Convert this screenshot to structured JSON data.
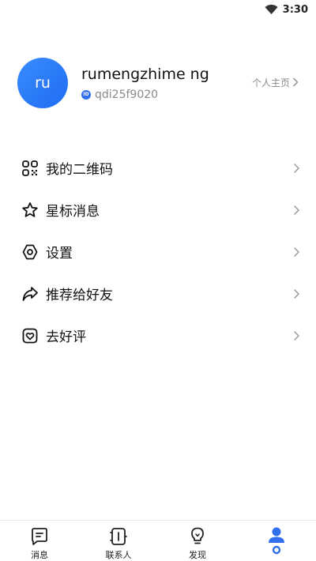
{
  "status_bar": {
    "time": "3:30",
    "wifi_icon": "wifi-icon"
  },
  "profile": {
    "avatar_text": "ru",
    "username": "rumengzhime ng",
    "id_badge": "ID",
    "id_value": "qdi25f9020",
    "homepage_link": "个人主页"
  },
  "menu": {
    "items": [
      {
        "label": "我的二维码",
        "icon": "qrcode-icon"
      },
      {
        "label": "星标消息",
        "icon": "star-icon"
      },
      {
        "label": "设置",
        "icon": "settings-icon"
      },
      {
        "label": "推荐给好友",
        "icon": "share-icon"
      },
      {
        "label": "去好评",
        "icon": "rate-icon"
      }
    ]
  },
  "bottom_nav": {
    "items": [
      {
        "label": "消息",
        "icon": "message-icon"
      },
      {
        "label": "联系人",
        "icon": "contacts-icon"
      },
      {
        "label": "发现",
        "icon": "discover-icon"
      },
      {
        "label": "",
        "icon": "profile-icon",
        "active": true
      }
    ]
  },
  "colors": {
    "accent": "#2f6ff0",
    "avatar": "#2a7cf7",
    "muted_text": "#8a8a8a"
  }
}
